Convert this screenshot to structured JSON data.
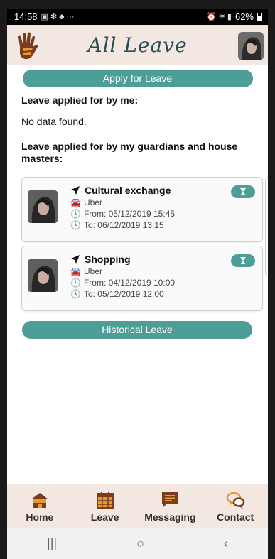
{
  "status": {
    "time": "14:58",
    "battery": "62%"
  },
  "header": {
    "title": "All Leave"
  },
  "actions": {
    "apply_label": "Apply for Leave",
    "historical_label": "Historical Leave"
  },
  "mine": {
    "heading": "Leave applied for by me:",
    "empty": "No data found."
  },
  "guardians": {
    "heading": "Leave applied for by my guardians and house masters:",
    "items": [
      {
        "title": "Cultural exchange",
        "transport": "Uber",
        "from": "From: 05/12/2019 15:45",
        "to": "To: 06/12/2019 13:15"
      },
      {
        "title": "Shopping",
        "transport": "Uber",
        "from": "From: 04/12/2019 10:00",
        "to": "To: 05/12/2019 12:00"
      }
    ]
  },
  "nav": {
    "items": [
      {
        "label": "Home",
        "icon": "home-icon"
      },
      {
        "label": "Leave",
        "icon": "calendar-icon"
      },
      {
        "label": "Messaging",
        "icon": "message-icon"
      },
      {
        "label": "Contact",
        "icon": "chat-bubbles-icon"
      }
    ]
  },
  "colors": {
    "accent": "#4e9e98",
    "header_bg": "#f3e7e2",
    "title": "#2b4d55",
    "brand_orange": "#e59a2f",
    "brand_brown": "#7a3b1e"
  }
}
